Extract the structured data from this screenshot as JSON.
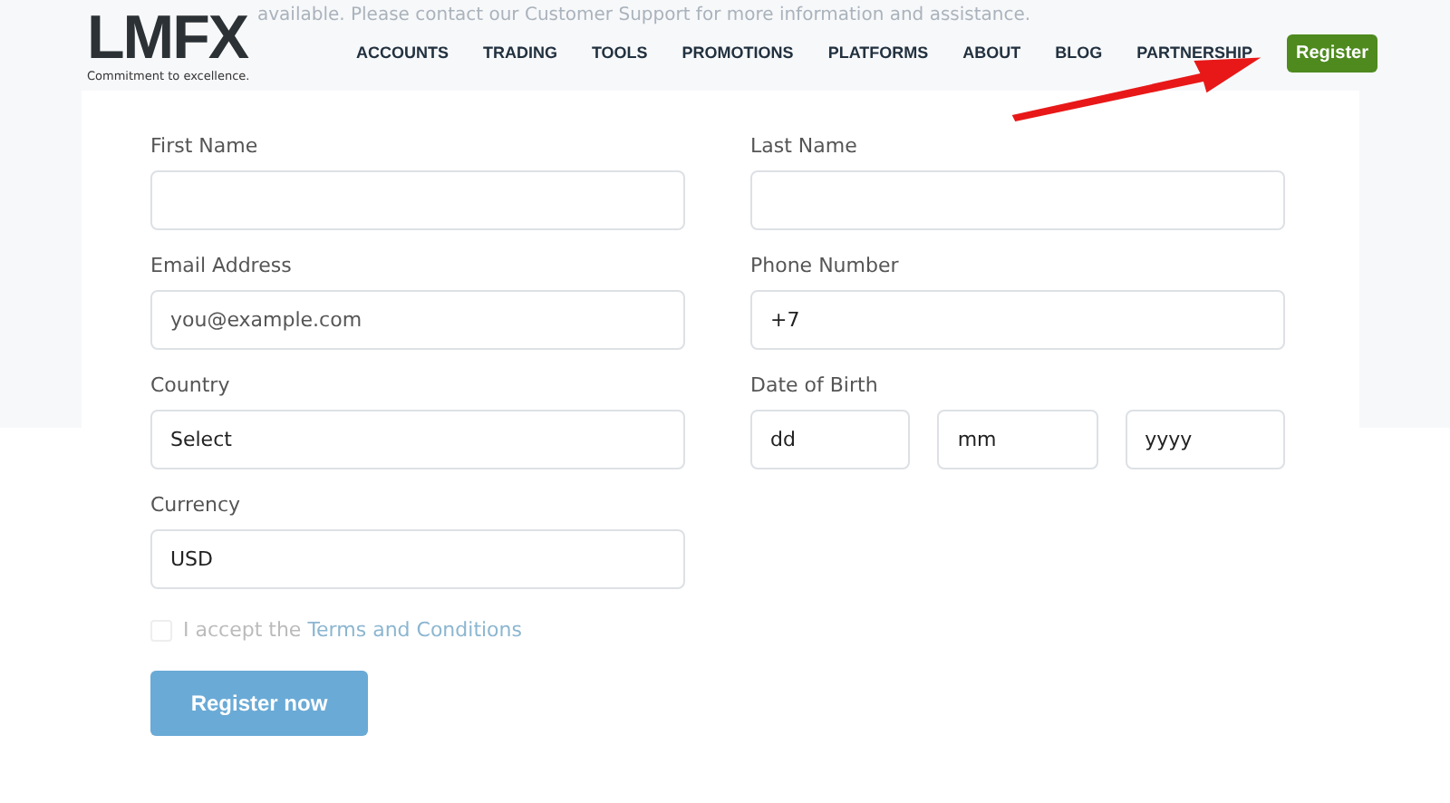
{
  "header": {
    "logo": "LMFX",
    "tagline": "Commitment to excellence.",
    "notice": "available. Please contact our Customer Support for more information and assistance.",
    "nav": [
      "ACCOUNTS",
      "TRADING",
      "TOOLS",
      "PROMOTIONS",
      "PLATFORMS",
      "ABOUT",
      "BLOG",
      "PARTNERSHIP"
    ],
    "register_button": "Register"
  },
  "form": {
    "fields": [
      {
        "label": "First Name",
        "kind": "text"
      },
      {
        "label": "Last Name",
        "kind": "text"
      },
      {
        "label": "Email Address",
        "kind": "text",
        "placeholder": "you@example.com"
      },
      {
        "label": "Phone Number",
        "kind": "text",
        "value": "+7"
      },
      {
        "label": "Country",
        "kind": "select",
        "value": "Select"
      },
      {
        "label": "Date of Birth",
        "kind": "date",
        "parts": [
          "dd",
          "mm",
          "yyyy"
        ]
      },
      {
        "label": "Currency",
        "kind": "select",
        "value": "USD"
      }
    ],
    "terms": {
      "checked": false,
      "text": "I accept the",
      "link": "Terms and Conditions"
    },
    "submit": {
      "label": "Register now",
      "disabled": true
    }
  }
}
